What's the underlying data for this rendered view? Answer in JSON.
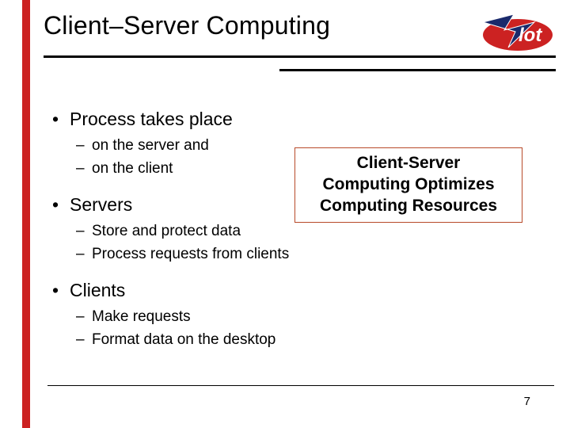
{
  "title": "Client–Server Computing",
  "logo": {
    "text": "lot",
    "letter": "Z"
  },
  "callout": {
    "line1": "Client-Server",
    "line2": "Computing Optimizes",
    "line3": "Computing Resources"
  },
  "bullets": {
    "process": {
      "title": "Process takes place",
      "sub1": "on the server and",
      "sub2": "on the client"
    },
    "servers": {
      "title": "Servers",
      "sub1": "Store and protect data",
      "sub2": "Process requests from clients"
    },
    "clients": {
      "title": "Clients",
      "sub1": "Make requests",
      "sub2": "Format data on the desktop"
    }
  },
  "page_number": "7"
}
